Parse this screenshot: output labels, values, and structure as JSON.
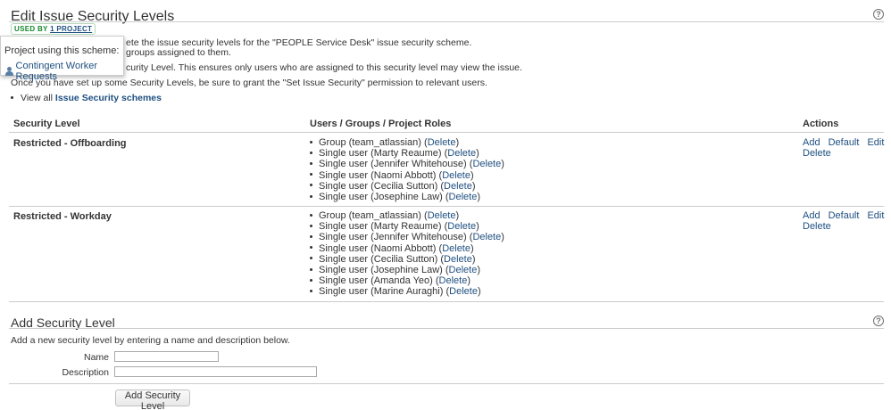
{
  "header": {
    "title": "Edit Issue Security Levels",
    "used_by_prefix": "USED BY",
    "used_by_link": "1 PROJECT",
    "help_icon": "?"
  },
  "intro": {
    "line1": "ete the issue security levels for the \"PEOPLE Service Desk\" issue security scheme.",
    "line2": "groups assigned to them.",
    "line3": "curity Level. This ensures only users who are assigned to this security level may view the issue.",
    "line4": "Once you have set up some Security Levels, be sure to grant the \"Set Issue Security\" permission to relevant users.",
    "view_all_prefix": "View all",
    "view_all_link": "Issue Security schemes"
  },
  "popup": {
    "title": "Project using this scheme:",
    "project_link": "Contingent Worker Requests",
    "icon": "project-user-icon"
  },
  "table": {
    "headers": [
      "Security Level",
      "Users / Groups / Project Roles",
      "Actions"
    ],
    "actions": {
      "add": "Add",
      "default": "Default",
      "edit": "Edit",
      "delete": "Delete"
    },
    "levels": [
      {
        "name": "Restricted - Offboarding",
        "members": [
          {
            "text": "Group (team_atlassian)",
            "delete": "Delete"
          },
          {
            "text": "Single user (Marty Reaume)",
            "delete": "Delete"
          },
          {
            "text": "Single user (Jennifer Whitehouse)",
            "delete": "Delete"
          },
          {
            "text": "Single user (Naomi Abbott)",
            "delete": "Delete"
          },
          {
            "text": "Single user (Cecilia Sutton)",
            "delete": "Delete"
          },
          {
            "text": "Single user (Josephine Law)",
            "delete": "Delete"
          }
        ]
      },
      {
        "name": "Restricted - Workday",
        "members": [
          {
            "text": "Group (team_atlassian)",
            "delete": "Delete"
          },
          {
            "text": "Single user (Marty Reaume)",
            "delete": "Delete"
          },
          {
            "text": "Single user (Jennifer Whitehouse)",
            "delete": "Delete"
          },
          {
            "text": "Single user (Naomi Abbott)",
            "delete": "Delete"
          },
          {
            "text": "Single user (Cecilia Sutton)",
            "delete": "Delete"
          },
          {
            "text": "Single user (Josephine Law)",
            "delete": "Delete"
          },
          {
            "text": "Single user (Amanda Yeo)",
            "delete": "Delete"
          },
          {
            "text": "Single user (Marine Auraghi)",
            "delete": "Delete"
          }
        ]
      }
    ]
  },
  "add_form": {
    "title": "Add Security Level",
    "description": "Add a new security level by entering a name and description below.",
    "name_label": "Name",
    "name_value": "",
    "description_label": "Description",
    "description_value": "",
    "submit_label": "Add Security Level"
  },
  "colors": {
    "link": "#205081",
    "used_by_badge": "#14892c"
  }
}
